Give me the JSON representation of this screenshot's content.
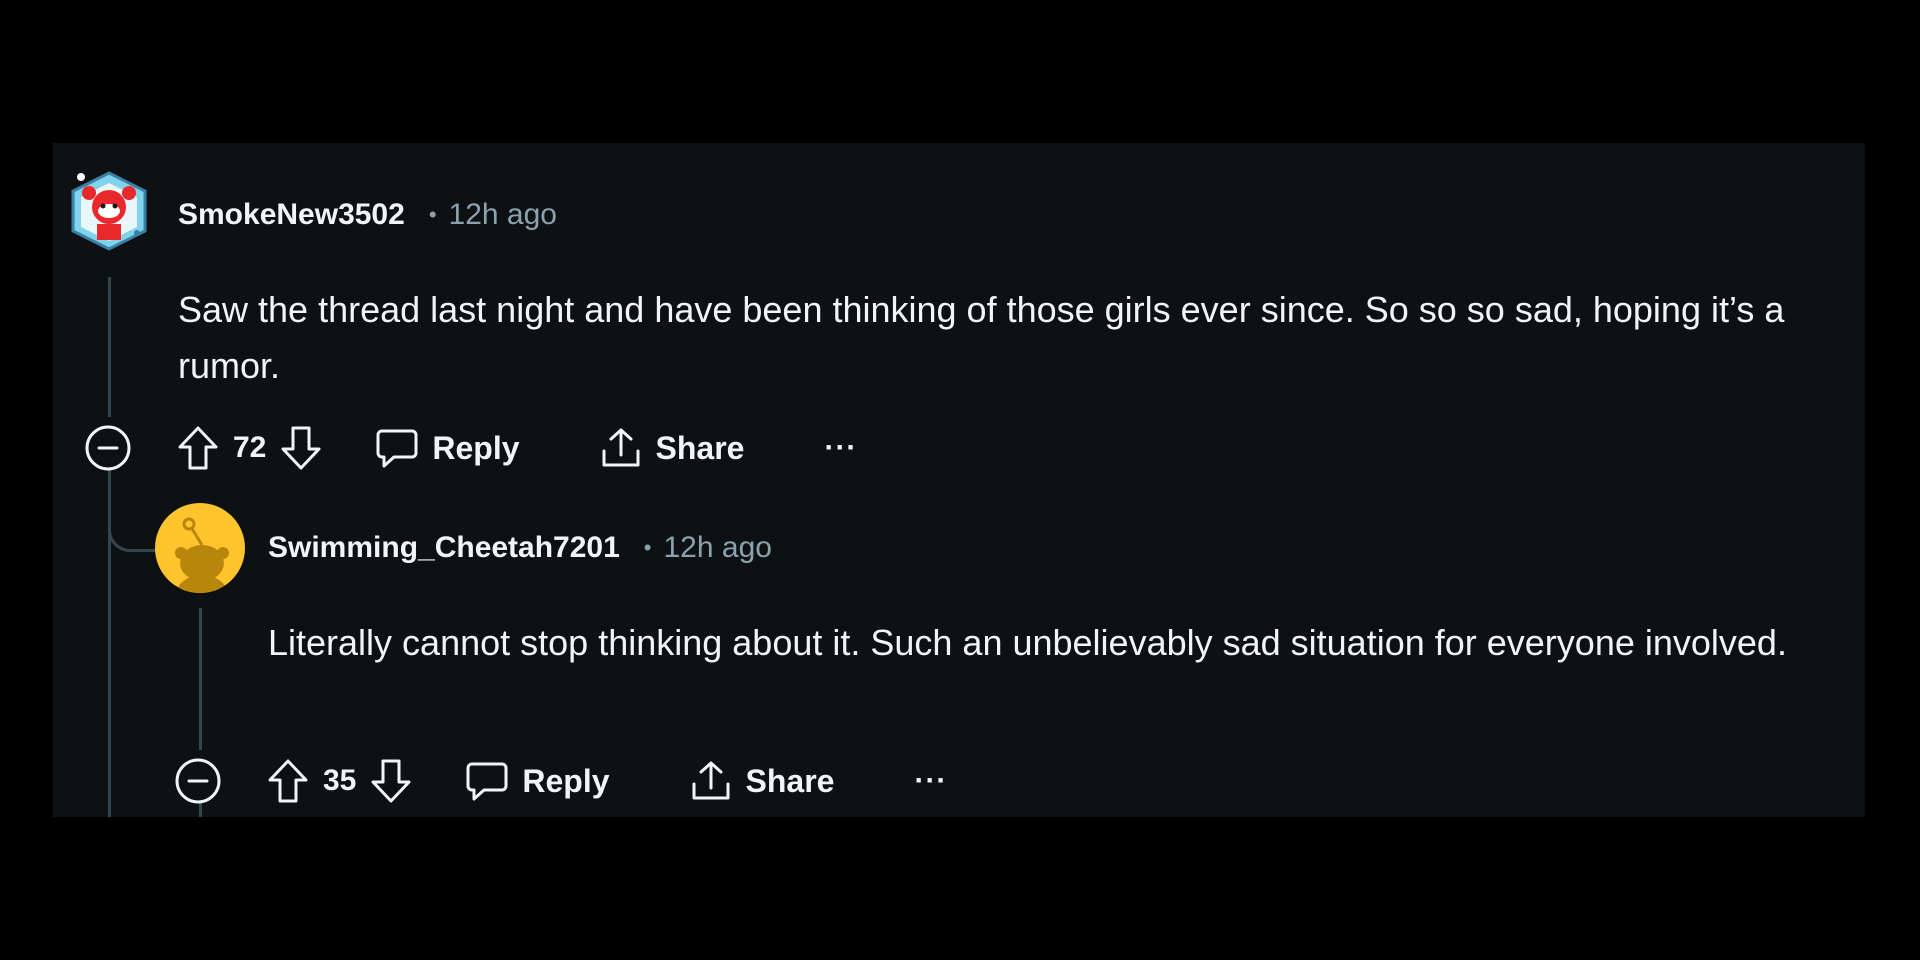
{
  "comments": [
    {
      "username": "SmokeNew3502",
      "separator": "•",
      "timestamp": "12h ago",
      "body": "Saw the thread last night and have been thinking of those girls ever since. So so so sad, hoping it’s a rumor.",
      "votes": "72",
      "reply_label": "Reply",
      "share_label": "Share",
      "more_label": "···"
    },
    {
      "username": "Swimming_Cheetah7201",
      "separator": "•",
      "timestamp": "12h ago",
      "body": "Literally cannot stop thinking about it. Such an unbelievably sad situation for everyone involved.",
      "votes": "35",
      "reply_label": "Reply",
      "share_label": "Share",
      "more_label": "···"
    }
  ],
  "colors": {
    "background": "#000000",
    "panel": "#0e1113",
    "text": "#f2f4f5",
    "muted": "#8ba2ad",
    "thread_line": "#33464c",
    "avatar_yellow": "#ffc42e"
  },
  "icons": {
    "collapse": "collapse-circle-minus-icon",
    "upvote": "upvote-arrow-icon",
    "downvote": "downvote-arrow-icon",
    "reply": "speech-bubble-icon",
    "share": "share-upload-icon",
    "more": "ellipsis-icon"
  }
}
